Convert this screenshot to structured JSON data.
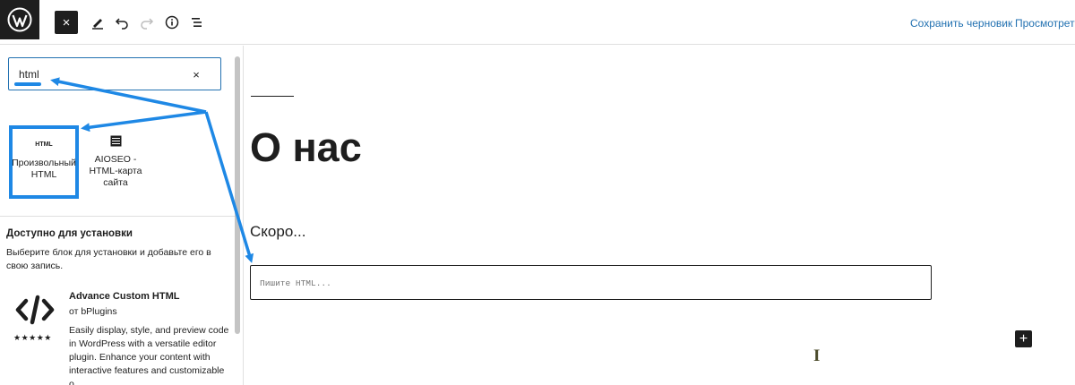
{
  "topbar": {
    "close_icon": "×",
    "save_draft_label": "Сохранить черновик",
    "preview_label": "Просмотреть"
  },
  "sidebar": {
    "search": {
      "value": "html",
      "placeholder": "",
      "clear_icon": "×"
    },
    "blocks": [
      {
        "label": "Произвольный HTML",
        "icon_text": "HTML",
        "icon": "html-icon",
        "selected": true
      },
      {
        "label": "AIOSEO - HTML-карта сайта",
        "icon": "sitemap-list-icon",
        "selected": false
      }
    ],
    "installable": {
      "title": "Доступно для установки",
      "description": "Выберите блок для установки и добавьте его в свою запись.",
      "plugins": [
        {
          "name": "Advance Custom HTML",
          "author": "от bPlugins",
          "stars": "★★★★★",
          "description": "Easily display, style, and preview code in WordPress with a versatile editor plugin. Enhance your content with interactive features and customizable o ..."
        }
      ]
    }
  },
  "canvas": {
    "title": "О нас",
    "paragraph": "Скоро...",
    "html_placeholder": "Пишите HTML...",
    "add_block_icon": "+"
  },
  "colors": {
    "accent": "#2271b1",
    "annotation": "#1e88e5",
    "dark": "#1e1e1e"
  }
}
